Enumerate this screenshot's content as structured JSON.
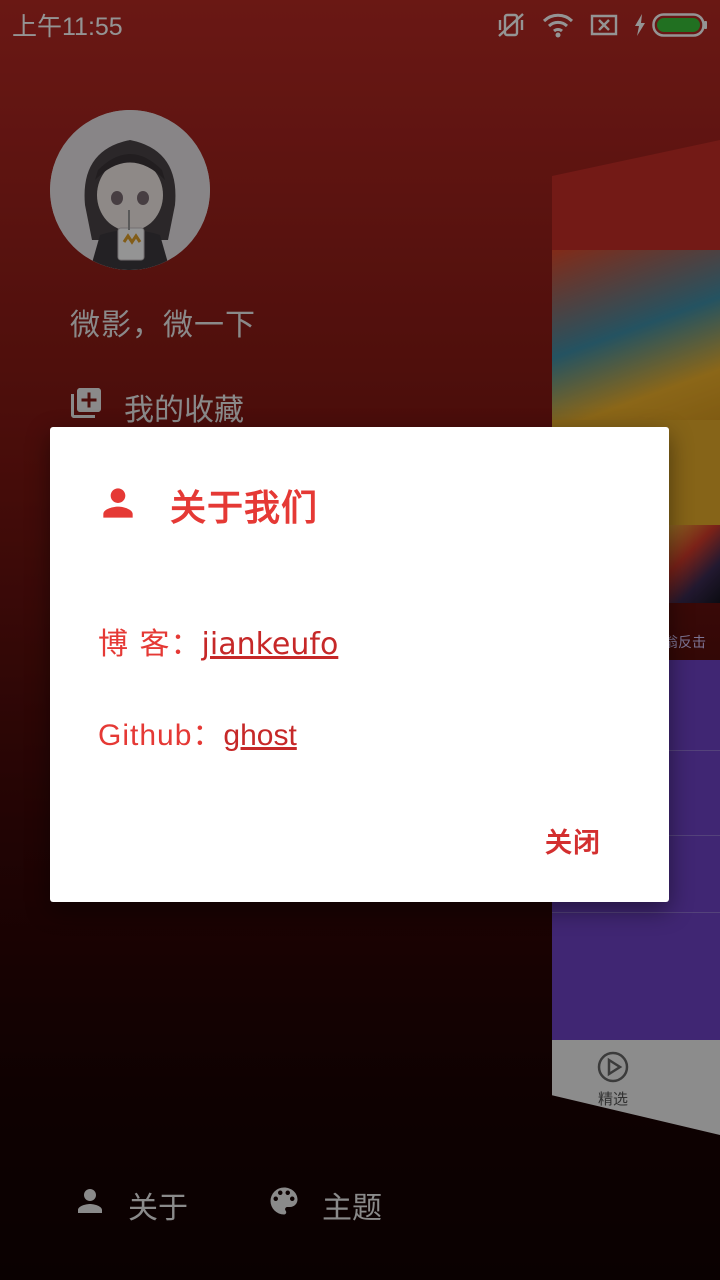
{
  "status_bar": {
    "time": "上午11:55",
    "icons": [
      "vibrate-off-icon",
      "wifi-icon",
      "sim-error-icon",
      "charging-icon",
      "battery-icon"
    ],
    "battery_color": "#3ac23a"
  },
  "drawer": {
    "title": "微影，微一下",
    "items": [
      {
        "label": "我的收藏",
        "icon": "add-box-icon"
      },
      {
        "label": "关于",
        "icon": "person-icon"
      },
      {
        "label": "主题",
        "icon": "palette-icon"
      }
    ]
  },
  "background_app": {
    "poster_caption": "翁反击",
    "nav_label": "精选"
  },
  "dialog": {
    "title": "关于我们",
    "blog_label": "博 客：",
    "blog_link": "jiankeufo",
    "github_label": "Github：",
    "github_link": "ghost",
    "close_label": "关闭"
  },
  "colors": {
    "accent": "#e53935",
    "drawer_bg_top": "#b72a24",
    "drawer_bg_bottom": "#120202"
  }
}
